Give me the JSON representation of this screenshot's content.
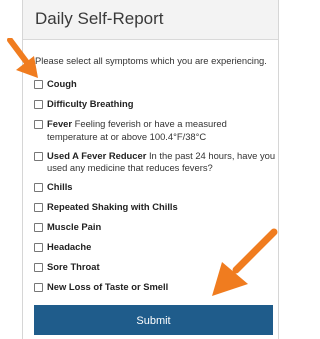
{
  "form": {
    "title": "Daily Self-Report",
    "instructions": "Please select all symptoms which you are experiencing.",
    "symptoms": [
      {
        "label": "Cough",
        "description": ""
      },
      {
        "label": "Difficulty Breathing",
        "description": ""
      },
      {
        "label": "Fever",
        "description": " Feeling feverish or have a measured temperature at or above 100.4°F/38°C"
      },
      {
        "label": "Used A Fever Reducer",
        "description": " In the past 24 hours, have you used any medicine that reduces fevers?"
      },
      {
        "label": "Chills",
        "description": ""
      },
      {
        "label": "Repeated Shaking with Chills",
        "description": ""
      },
      {
        "label": "Muscle Pain",
        "description": ""
      },
      {
        "label": "Headache",
        "description": ""
      },
      {
        "label": "Sore Throat",
        "description": ""
      },
      {
        "label": "New Loss of Taste or Smell",
        "description": ""
      }
    ],
    "submit_label": "Submit"
  },
  "colors": {
    "submit_bg": "#1f5c8b",
    "arrow": "#f07c1f",
    "header_bg": "#f3f3f3"
  },
  "icons": [
    "arrow-top-left-icon",
    "arrow-bottom-right-icon",
    "checkbox-icon"
  ]
}
